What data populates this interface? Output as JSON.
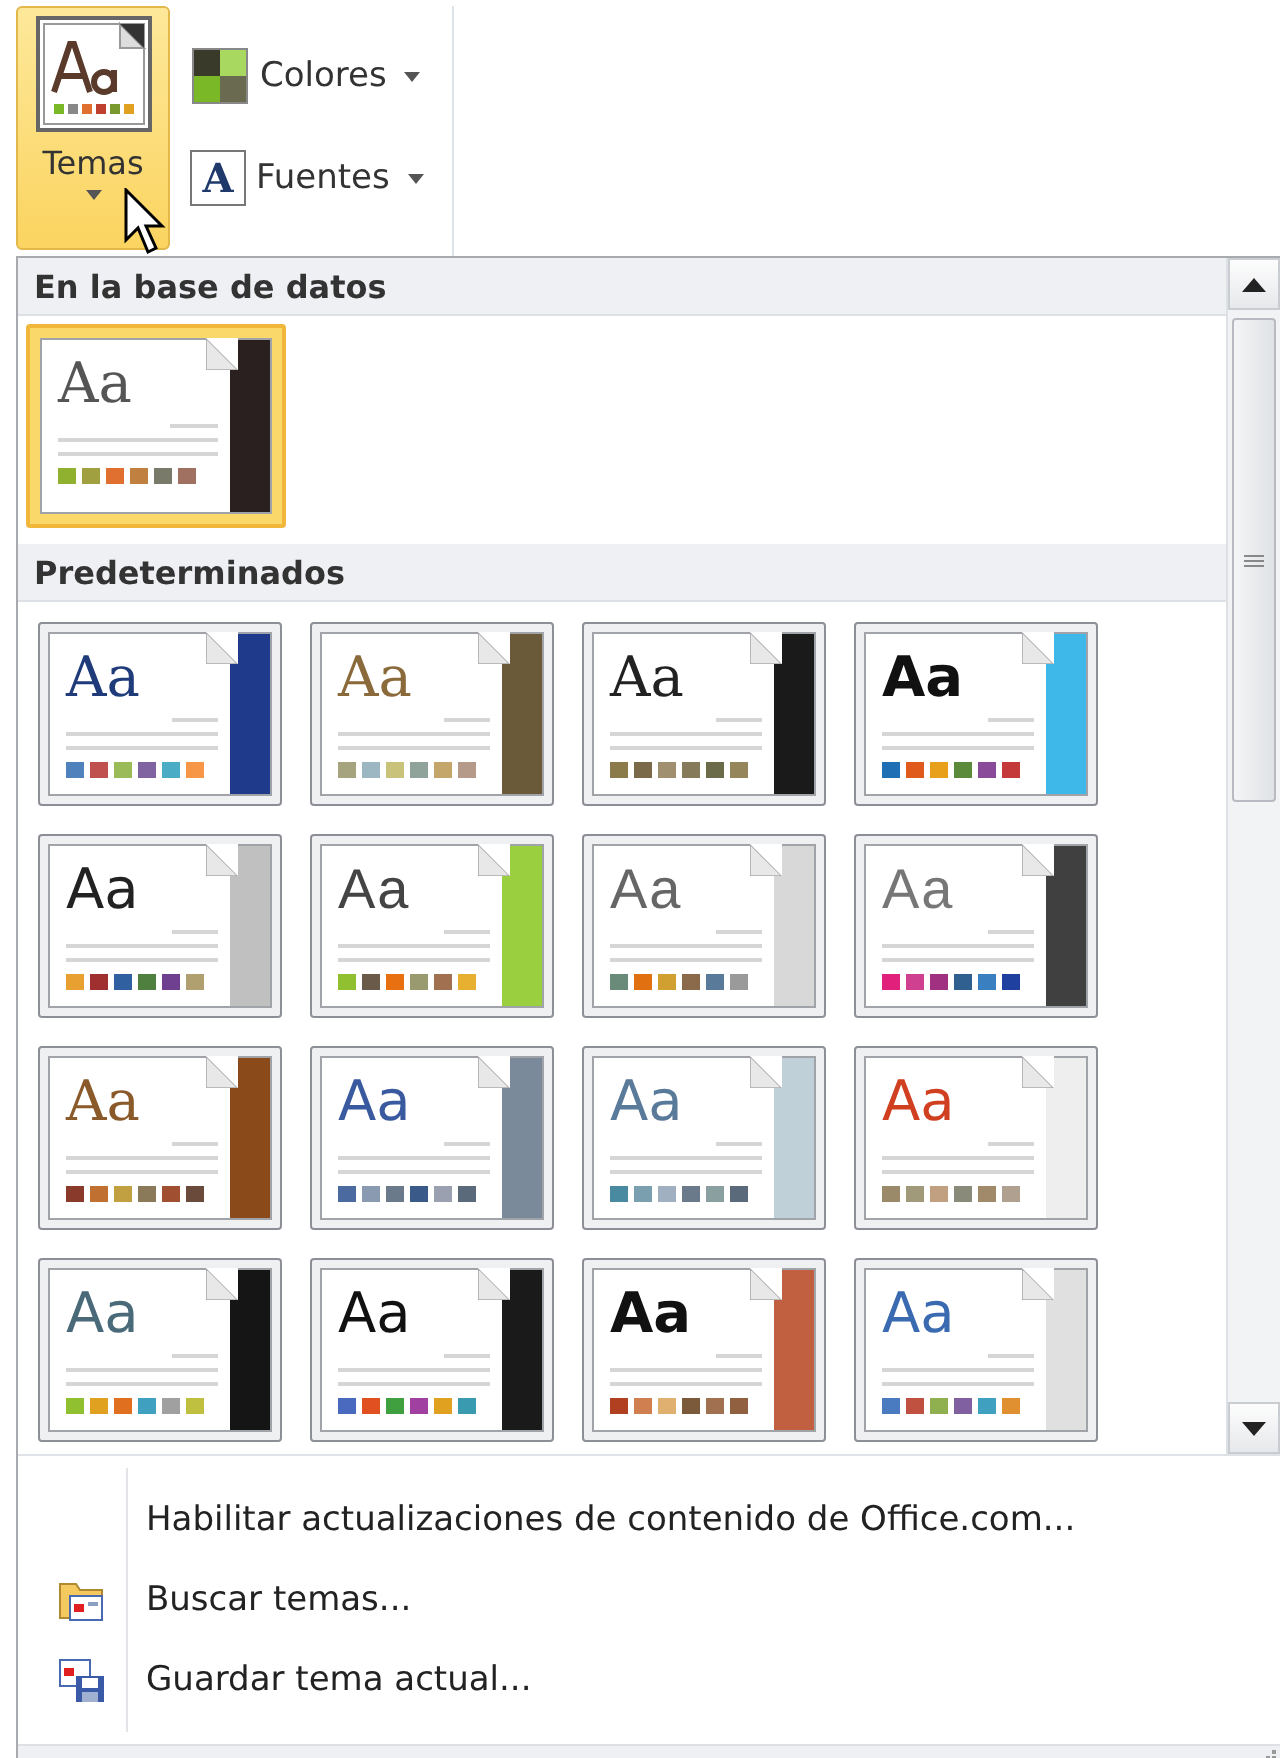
{
  "ribbon": {
    "themes_button": {
      "label": "Temas",
      "selected": true
    },
    "small_buttons": [
      {
        "kind": "colors",
        "label": "Colores"
      },
      {
        "kind": "fonts",
        "label": "Fuentes",
        "glyph": "A"
      }
    ]
  },
  "gallery": {
    "sections": [
      {
        "title": "En la base de datos",
        "themes": [
          {
            "sample": {
              "text": "Aa",
              "color": "#555555"
            },
            "kind": "serif",
            "selected": true,
            "color": "#2a2020",
            "swatches": [
              {
                "color": "#90b030"
              },
              {
                "color": "#a0a040"
              },
              {
                "color": "#e07030"
              },
              {
                "color": "#c08040"
              },
              {
                "color": "#7a7a6a"
              },
              {
                "color": "#a07060"
              }
            ]
          }
        ]
      },
      {
        "title": "Predeterminados",
        "themes": [
          {
            "sample": {
              "text": "Aa",
              "color": "#1f3b7a"
            },
            "kind": "serif",
            "selected": false,
            "color": "#1f3a8a",
            "swatches": [
              {
                "color": "#4f81bd"
              },
              {
                "color": "#c0504d"
              },
              {
                "color": "#9bbb59"
              },
              {
                "color": "#8064a2"
              },
              {
                "color": "#4bacc6"
              },
              {
                "color": "#f79646"
              }
            ]
          },
          {
            "sample": {
              "text": "Aa",
              "color": "#8a6a3a"
            },
            "kind": "serif",
            "selected": false,
            "color": "#6b5a3a",
            "swatches": [
              {
                "color": "#a5a47f"
              },
              {
                "color": "#9cb7c2"
              },
              {
                "color": "#c9c27a"
              },
              {
                "color": "#8fa39b"
              },
              {
                "color": "#c4a56a"
              },
              {
                "color": "#b59a89"
              }
            ]
          },
          {
            "sample": {
              "text": "Aa",
              "color": "#222222"
            },
            "kind": "serif",
            "selected": false,
            "color": "#1a1a1a",
            "swatches": [
              {
                "color": "#8b7a4a"
              },
              {
                "color": "#7a6a4a"
              },
              {
                "color": "#a09070"
              },
              {
                "color": "#857a5a"
              },
              {
                "color": "#6b6b4a"
              },
              {
                "color": "#95855a"
              }
            ]
          },
          {
            "sample": {
              "text": "Aa",
              "color": "#111111"
            },
            "kind": "bold",
            "selected": false,
            "color": "#3db8e8",
            "swatches": [
              {
                "color": "#1f6fb5"
              },
              {
                "color": "#e05a1b"
              },
              {
                "color": "#e8a01b"
              },
              {
                "color": "#5a8a3a"
              },
              {
                "color": "#8a4a9a"
              },
              {
                "color": "#c43a3a"
              }
            ]
          },
          {
            "sample": {
              "text": "Aa",
              "color": "#222222"
            },
            "kind": "sans",
            "selected": false,
            "color": "#c0c0c0",
            "swatches": [
              {
                "color": "#e8a030"
              },
              {
                "color": "#a03030"
              },
              {
                "color": "#3060a0"
              },
              {
                "color": "#508040"
              },
              {
                "color": "#704090"
              },
              {
                "color": "#b0a070"
              }
            ]
          },
          {
            "sample": {
              "text": "Aa",
              "color": "#444444"
            },
            "kind": "light",
            "selected": false,
            "color": "#9ad040",
            "swatches": [
              {
                "color": "#90c030"
              },
              {
                "color": "#6a5a4a"
              },
              {
                "color": "#e87010"
              },
              {
                "color": "#9a9a70"
              },
              {
                "color": "#a07050"
              },
              {
                "color": "#e8b030"
              }
            ]
          },
          {
            "sample": {
              "text": "Aa",
              "color": "#666666"
            },
            "kind": "light",
            "selected": false,
            "color": "#d8d8d8",
            "swatches": [
              {
                "color": "#6a8a7a"
              },
              {
                "color": "#e07010"
              },
              {
                "color": "#d0a030"
              },
              {
                "color": "#8a6a4a"
              },
              {
                "color": "#5a7a9a"
              },
              {
                "color": "#9a9a9a"
              }
            ]
          },
          {
            "sample": {
              "text": "Aa",
              "color": "#777777"
            },
            "kind": "light",
            "selected": false,
            "color": "#404040",
            "swatches": [
              {
                "color": "#e0207a"
              },
              {
                "color": "#d04090"
              },
              {
                "color": "#a03080"
              },
              {
                "color": "#306090"
              },
              {
                "color": "#3a80c0"
              },
              {
                "color": "#2040a0"
              }
            ]
          },
          {
            "sample": {
              "text": "Aa",
              "color": "#8a5a2a"
            },
            "kind": "serif",
            "selected": false,
            "color": "#8a4a1a",
            "swatches": [
              {
                "color": "#8a3a2a"
              },
              {
                "color": "#c07030"
              },
              {
                "color": "#c0a040"
              },
              {
                "color": "#8a7a5a"
              },
              {
                "color": "#a05030"
              },
              {
                "color": "#6a4a3a"
              }
            ]
          },
          {
            "sample": {
              "text": "Aa",
              "color": "#3a5aa0"
            },
            "kind": "sans",
            "selected": false,
            "color": "#7a8a9a",
            "swatches": [
              {
                "color": "#4a6aa0"
              },
              {
                "color": "#8a9ab0"
              },
              {
                "color": "#6a7a8a"
              },
              {
                "color": "#3a5a8a"
              },
              {
                "color": "#9aa0b0"
              },
              {
                "color": "#5a6a7a"
              }
            ]
          },
          {
            "sample": {
              "text": "Aa",
              "color": "#5a7a9a"
            },
            "kind": "sans",
            "selected": false,
            "color": "#c0d0d8",
            "swatches": [
              {
                "color": "#4a8aa0"
              },
              {
                "color": "#7aa0b0"
              },
              {
                "color": "#a0b0c0"
              },
              {
                "color": "#6a7a8a"
              },
              {
                "color": "#8aa0a0"
              },
              {
                "color": "#5a6a7a"
              }
            ]
          },
          {
            "sample": {
              "text": "Aa",
              "color": "#d04020"
            },
            "kind": "sans",
            "selected": false,
            "color": "#eeeeee",
            "swatches": [
              {
                "color": "#9a8a6a"
              },
              {
                "color": "#a09a7a"
              },
              {
                "color": "#c0a080"
              },
              {
                "color": "#8a8a7a"
              },
              {
                "color": "#a08a6a"
              },
              {
                "color": "#b0a090"
              }
            ]
          },
          {
            "sample": {
              "text": "Aa",
              "color": "#4a6a7a"
            },
            "kind": "sans",
            "selected": false,
            "color": "#151515",
            "swatches": [
              {
                "color": "#90c030"
              },
              {
                "color": "#e0a020"
              },
              {
                "color": "#e07020"
              },
              {
                "color": "#40a0c0"
              },
              {
                "color": "#a0a0a0"
              },
              {
                "color": "#c0c040"
              }
            ]
          },
          {
            "sample": {
              "text": "Aa",
              "color": "#111111"
            },
            "kind": "sans",
            "selected": false,
            "color": "#1a1a1a",
            "swatches": [
              {
                "color": "#4a6ac0"
              },
              {
                "color": "#e05020"
              },
              {
                "color": "#40a040"
              },
              {
                "color": "#a040a0"
              },
              {
                "color": "#e0a020"
              },
              {
                "color": "#3a9ab0"
              }
            ]
          },
          {
            "sample": {
              "text": "Aa",
              "color": "#111111"
            },
            "kind": "bold",
            "selected": false,
            "color": "#c06040",
            "swatches": [
              {
                "color": "#b04020"
              },
              {
                "color": "#d08050"
              },
              {
                "color": "#e0b070"
              },
              {
                "color": "#7a5a3a"
              },
              {
                "color": "#a07050"
              },
              {
                "color": "#906040"
              }
            ]
          },
          {
            "sample": {
              "text": "Aa",
              "color": "#3a6ab0"
            },
            "kind": "sans",
            "selected": false,
            "color": "#e0e0e0",
            "swatches": [
              {
                "color": "#4a7ac0"
              },
              {
                "color": "#c05040"
              },
              {
                "color": "#90b050"
              },
              {
                "color": "#8060a0"
              },
              {
                "color": "#40a0c0"
              },
              {
                "color": "#e09030"
              }
            ]
          }
        ]
      }
    ]
  },
  "menu": [
    {
      "kind": "text",
      "label": "Habilitar actualizaciones de contenido de Office.com..."
    },
    {
      "kind": "browse",
      "label": "Buscar temas..."
    },
    {
      "kind": "save",
      "label": "Guardar tema actual..."
    }
  ]
}
